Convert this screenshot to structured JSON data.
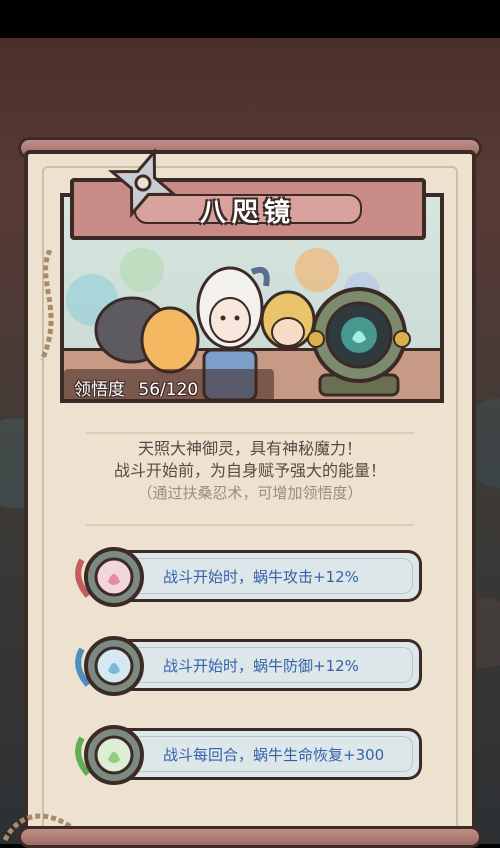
{
  "title": "八咫镜",
  "understanding": {
    "label": "领悟度",
    "current": 56,
    "max": 120,
    "display": "56/120"
  },
  "description": {
    "line1": "天照大神御灵，具有神秘魔力！",
    "line2": "战斗开始前，为自身赋予强大的能量！",
    "hint": "（通过扶桑忍术，可增加领悟度）"
  },
  "perks": [
    {
      "text": "战斗开始时，蜗牛攻击+12%",
      "gem_color": "#e58b9c",
      "icon": "pink-gem-icon"
    },
    {
      "text": "战斗开始时，蜗牛防御+12%",
      "gem_color": "#7fb7d9",
      "icon": "blue-gem-icon"
    },
    {
      "text": "战斗每回合，蜗牛生命恢复+300",
      "gem_color": "#8fcf7a",
      "icon": "green-gem-icon"
    }
  ],
  "colors": {
    "panel": "#ece2cf",
    "outline": "#3c2a27",
    "banner": "#c98b86",
    "perk_text": "#3562a8"
  }
}
